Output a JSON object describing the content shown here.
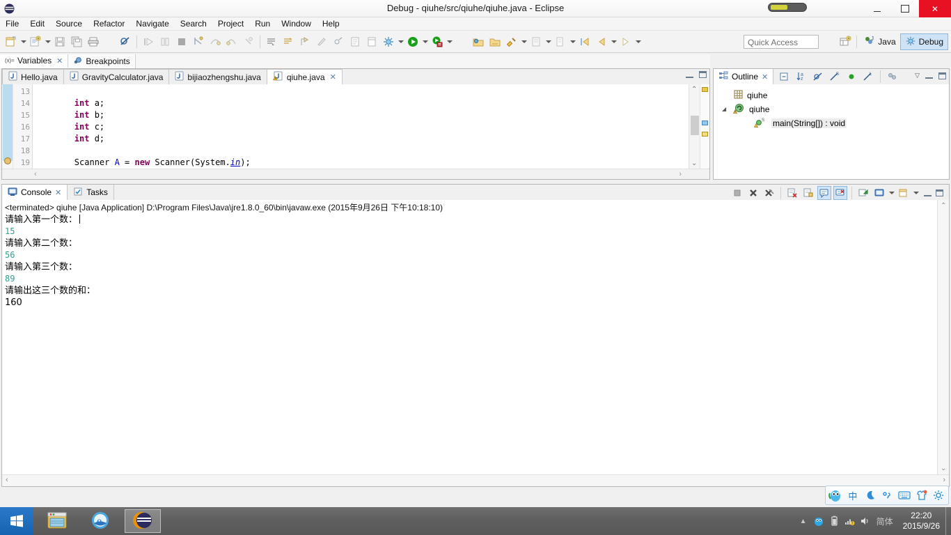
{
  "window": {
    "title": "Debug - qiuhe/src/qiuhe/qiuhe.java - Eclipse",
    "app_icon": "eclipse-icon",
    "minimize_label": "",
    "maximize_label": "",
    "close_label": ""
  },
  "menubar": {
    "items": [
      "File",
      "Edit",
      "Source",
      "Refactor",
      "Navigate",
      "Search",
      "Project",
      "Run",
      "Window",
      "Help"
    ]
  },
  "toolbar": {
    "quick_access_placeholder": "Quick Access",
    "perspectives": [
      {
        "label": "Java",
        "icon": "java-perspective-icon",
        "active": false
      },
      {
        "label": "Debug",
        "icon": "debug-perspective-icon",
        "active": true
      }
    ],
    "open_perspective_icon": "open-perspective-icon",
    "icons": [
      "new-wizard-icon",
      "new-java-class-icon",
      "save-icon",
      "save-all-icon",
      "print-icon",
      "toggle-breakpoint-icon",
      "resume-icon",
      "suspend-icon",
      "terminate-icon",
      "step-into-icon",
      "step-over-icon",
      "step-return-icon",
      "drop-to-frame-icon",
      "use-step-filters-icon",
      "next-annotation-icon",
      "previous-annotation-icon",
      "last-edit-location-icon",
      "toggle-mark-occurrences-icon",
      "toggle-block-selection-icon",
      "debug-run-icon",
      "run-icon",
      "external-tools-icon",
      "new-java-project-icon",
      "new-package-icon",
      "search-icon",
      "open-type-icon",
      "open-task-icon",
      "back-icon",
      "forward-icon"
    ]
  },
  "debug_view_tabs": [
    {
      "label": "Variables",
      "icon": "variables-icon",
      "selected": true,
      "closable": true
    },
    {
      "label": "Breakpoints",
      "icon": "breakpoints-icon",
      "selected": false,
      "closable": false
    }
  ],
  "editor": {
    "tabs": [
      {
        "label": "Hello.java",
        "icon": "java-file-icon",
        "selected": false,
        "closable": false
      },
      {
        "label": "GravityCalculator.java",
        "icon": "java-file-icon",
        "selected": false,
        "closable": false
      },
      {
        "label": "bijiaozhengshu.java",
        "icon": "java-file-icon",
        "selected": false,
        "closable": false
      },
      {
        "label": "qiuhe.java",
        "icon": "java-file-warning-icon",
        "selected": true,
        "closable": true
      }
    ],
    "line_numbers": [
      "13",
      "14",
      "15",
      "16",
      "17",
      "18",
      "19"
    ],
    "lines": [
      {
        "indent": "",
        "tokens": []
      },
      {
        "indent": "        ",
        "tokens": [
          {
            "t": "int",
            "c": "kw"
          },
          {
            "t": " a;",
            "c": ""
          }
        ]
      },
      {
        "indent": "        ",
        "tokens": [
          {
            "t": "int",
            "c": "kw"
          },
          {
            "t": " b;",
            "c": ""
          }
        ]
      },
      {
        "indent": "        ",
        "tokens": [
          {
            "t": "int",
            "c": "kw"
          },
          {
            "t": " c;",
            "c": ""
          }
        ]
      },
      {
        "indent": "        ",
        "tokens": [
          {
            "t": "int",
            "c": "kw"
          },
          {
            "t": " d;",
            "c": ""
          }
        ]
      },
      {
        "indent": "",
        "tokens": []
      },
      {
        "indent": "        ",
        "tokens": [
          {
            "t": "Scanner ",
            "c": ""
          },
          {
            "t": "A",
            "c": "fld"
          },
          {
            "t": " = ",
            "c": ""
          },
          {
            "t": "new",
            "c": "kw"
          },
          {
            "t": " Scanner(System.",
            "c": ""
          },
          {
            "t": "in",
            "c": "ital"
          },
          {
            "t": ");",
            "c": ""
          }
        ]
      }
    ],
    "plain_lines": [
      "",
      "        int a;",
      "        int b;",
      "        int c;",
      "        int d;",
      "",
      "        Scanner A = new Scanner(System.in);"
    ]
  },
  "outline": {
    "tab_label": "Outline",
    "tab_icon": "outline-icon",
    "tools": [
      "collapse-all-icon",
      "sort-icon",
      "hide-fields-icon",
      "hide-static-icon",
      "hide-nonpublic-icon",
      "hide-local-types-icon",
      "link-with-editor-icon"
    ],
    "menu_icon": "view-menu-icon",
    "minimize_icon": "minimize-icon",
    "maximize_icon": "maximize-icon",
    "tree": [
      {
        "label": "qiuhe",
        "icon": "package-icon",
        "level": 1,
        "expandable": false,
        "selected": false
      },
      {
        "label": "qiuhe",
        "icon": "class-warning-icon",
        "level": 1,
        "expandable": true,
        "selected": false
      },
      {
        "label": "main(String[]) : void",
        "icon": "method-static-icon",
        "level": 2,
        "expandable": false,
        "selected": true
      }
    ]
  },
  "console": {
    "tabs": [
      {
        "label": "Console",
        "icon": "console-icon",
        "selected": true,
        "closable": true
      },
      {
        "label": "Tasks",
        "icon": "tasks-icon",
        "selected": false,
        "closable": false
      }
    ],
    "tools": [
      "terminate-icon",
      "remove-launch-icon",
      "remove-all-terminated-icon",
      "clear-console-icon",
      "scroll-lock-icon",
      "show-console-on-output-icon",
      "show-console-on-error-icon",
      "pin-console-icon",
      "display-selected-console-icon",
      "open-console-icon",
      "minimize-icon",
      "maximize-icon"
    ],
    "header": "<terminated> qiuhe [Java Application] D:\\Program Files\\Java\\jre1.8.0_60\\bin\\javaw.exe (2015年9月26日 下午10:18:10)",
    "output": [
      {
        "text": "请输入第一个数：",
        "kind": "text",
        "caret": true
      },
      {
        "text": "15",
        "kind": "input"
      },
      {
        "text": "请输入第二个数：",
        "kind": "text"
      },
      {
        "text": "56",
        "kind": "input"
      },
      {
        "text": "请输入第三个数：",
        "kind": "text"
      },
      {
        "text": "89",
        "kind": "input"
      },
      {
        "text": "请输出这三个数的和：",
        "kind": "text"
      },
      {
        "text": "160",
        "kind": "output"
      }
    ],
    "input_color": "#2e9e8f"
  },
  "ime": {
    "items": [
      "sogou-logo-icon",
      "中",
      "moon-icon",
      "punctuation-icon",
      "keyboard-icon",
      "skin-icon",
      "settings-icon"
    ]
  },
  "taskbar": {
    "start_icon": "windows-start-icon",
    "items": [
      {
        "icon": "file-explorer-icon",
        "active": false
      },
      {
        "icon": "internet-explorer-icon",
        "active": false
      },
      {
        "icon": "eclipse-icon",
        "active": true
      }
    ],
    "tray_icons": [
      "show-hidden-icons-icon",
      "usb-safely-remove-icon",
      "battery-icon",
      "network-icon",
      "volume-icon"
    ],
    "language": "简体",
    "time": "22:20",
    "date": "2015/9/26"
  },
  "colors": {
    "accent": "#cfe3f7",
    "close_red": "#e81123",
    "keyword": "#7f0055",
    "field": "#0000c0",
    "console_input": "#2e9e8f",
    "marker_highlight": "#b9dcf0"
  }
}
